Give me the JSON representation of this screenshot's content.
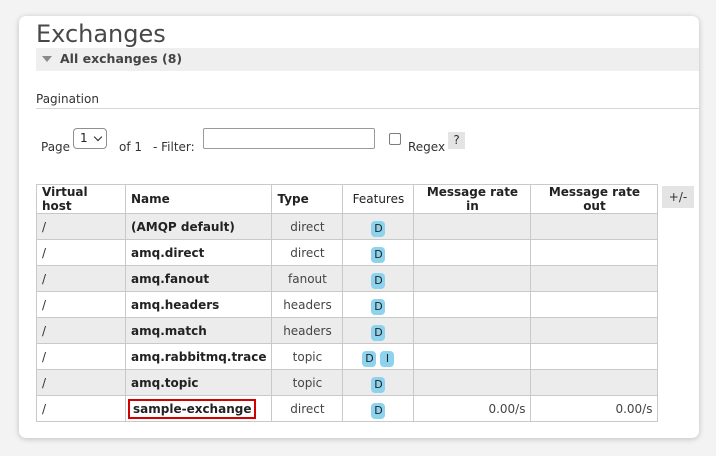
{
  "page": {
    "title": "Exchanges",
    "section_label": "All exchanges (8)"
  },
  "pagination": {
    "heading": "Pagination",
    "page_label": "Page",
    "page_value": "1",
    "of_label": "of 1",
    "filter_label": "- Filter:",
    "filter_value": "",
    "regex_label": "Regex",
    "help_label": "?"
  },
  "table": {
    "headers": {
      "vhost": "Virtual host",
      "name": "Name",
      "type": "Type",
      "features": "Features",
      "rate_in": "Message rate in",
      "rate_out": "Message rate out"
    },
    "columns_toggle": "+/-",
    "rows": [
      {
        "vhost": "/",
        "name": "(AMQP default)",
        "type": "direct",
        "features": [
          "D"
        ],
        "rate_in": "",
        "rate_out": ""
      },
      {
        "vhost": "/",
        "name": "amq.direct",
        "type": "direct",
        "features": [
          "D"
        ],
        "rate_in": "",
        "rate_out": ""
      },
      {
        "vhost": "/",
        "name": "amq.fanout",
        "type": "fanout",
        "features": [
          "D"
        ],
        "rate_in": "",
        "rate_out": ""
      },
      {
        "vhost": "/",
        "name": "amq.headers",
        "type": "headers",
        "features": [
          "D"
        ],
        "rate_in": "",
        "rate_out": ""
      },
      {
        "vhost": "/",
        "name": "amq.match",
        "type": "headers",
        "features": [
          "D"
        ],
        "rate_in": "",
        "rate_out": ""
      },
      {
        "vhost": "/",
        "name": "amq.rabbitmq.trace",
        "type": "topic",
        "features": [
          "D",
          "I"
        ],
        "rate_in": "",
        "rate_out": ""
      },
      {
        "vhost": "/",
        "name": "amq.topic",
        "type": "topic",
        "features": [
          "D"
        ],
        "rate_in": "",
        "rate_out": ""
      },
      {
        "vhost": "/",
        "name": "sample-exchange",
        "type": "direct",
        "features": [
          "D"
        ],
        "rate_in": "0.00/s",
        "rate_out": "0.00/s",
        "highlighted": true
      }
    ]
  },
  "colors": {
    "feature_badge": "#8ed3ee",
    "highlight_box": "#d40000",
    "row_alt": "#ececec"
  }
}
